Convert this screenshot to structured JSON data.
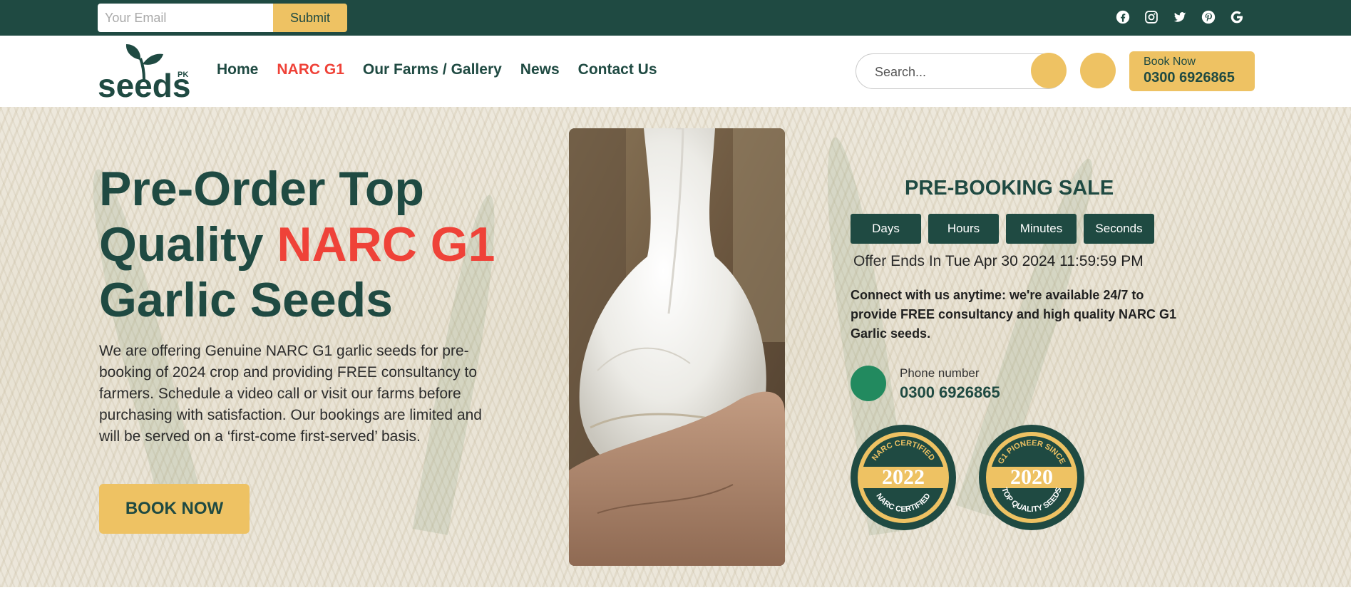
{
  "topbar": {
    "email_placeholder": "Your Email",
    "submit_label": "Submit",
    "socials": [
      "facebook-icon",
      "instagram-icon",
      "twitter-icon",
      "pinterest-icon",
      "google-icon"
    ]
  },
  "header": {
    "logo_text": "seeds",
    "logo_sub": "PK",
    "nav": [
      {
        "label": "Home",
        "active": false
      },
      {
        "label": "NARC G1",
        "active": true
      },
      {
        "label": "Our Farms / Gallery",
        "active": false
      },
      {
        "label": "News",
        "active": false
      },
      {
        "label": "Contact Us",
        "active": false
      }
    ],
    "search_placeholder": "Search...",
    "booknow_label": "Book Now",
    "booknow_phone": "0300 6926865"
  },
  "hero": {
    "title_part1": "Pre-Order Top Quality ",
    "title_accent": "NARC G1",
    "title_part2": " Garlic Seeds",
    "description": "We are offering Genuine NARC G1 garlic seeds for pre-booking of 2024 crop and providing FREE consultancy to farmers. Schedule a video call or visit our farms before purchasing with satisfaction. Our bookings are limited and will be served on a ‘first-come first-served’ basis.",
    "cta_label": "BOOK NOW"
  },
  "sale": {
    "title": "PRE-BOOKING SALE",
    "countdown": [
      "Days",
      "Hours",
      "Minutes",
      "Seconds"
    ],
    "offer_prefix": "Offer Ends In",
    "offer_date": "Tue Apr 30 2024 11:59:59 PM",
    "connect_text": "Connect with us anytime: we're available 24/7 to provide FREE consultancy and high quality NARC G1 Garlic seeds.",
    "phone_label": "Phone number",
    "phone_number": "0300 6926865"
  },
  "badges": [
    {
      "top": "NARC CERTIFIED",
      "year": "2022",
      "bottom": "NARC CERTIFIED"
    },
    {
      "top": "G1 PIONEER SINCE",
      "year": "2020",
      "bottom": "TOP QUALITY SEEDS"
    }
  ],
  "colors": {
    "brand_dark": "#1f4a42",
    "accent_yellow": "#eec263",
    "accent_red": "#ef4238",
    "phone_green": "#228a5f"
  }
}
